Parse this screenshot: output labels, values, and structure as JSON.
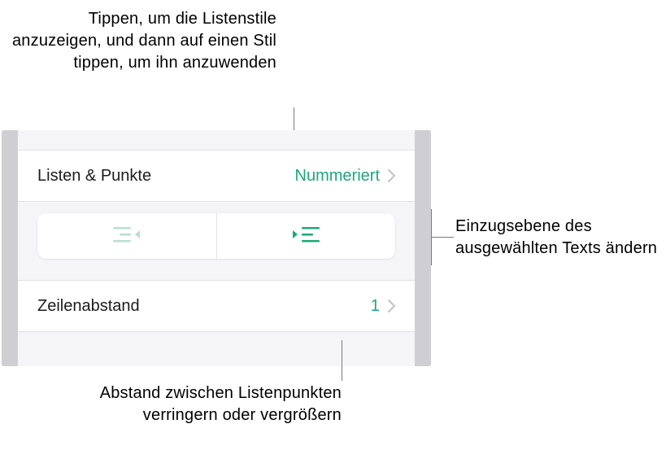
{
  "callouts": {
    "top": "Tippen, um die Listenstile anzuzeigen, und dann auf einen Stil tippen, um ihn anzuwenden",
    "right": "Einzugsebene des ausgewählten Texts ändern",
    "bottom": "Abstand zwischen Listenpunkten verringern oder vergrößern"
  },
  "panel": {
    "lists_label": "Listen & Punkte",
    "lists_value": "Nummeriert",
    "spacing_label": "Zeilenabstand",
    "spacing_value": "1"
  },
  "colors": {
    "accent": "#1ca87a",
    "disabled": "#b8dfd0"
  }
}
